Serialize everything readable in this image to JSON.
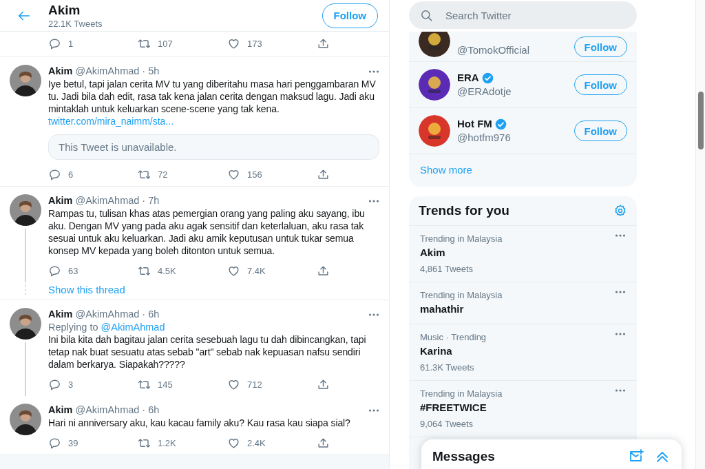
{
  "header": {
    "title": "Akim",
    "subtitle": "22.1K Tweets",
    "follow_button": "Follow"
  },
  "previous_actions": {
    "replies": "1",
    "retweets": "107",
    "likes": "173"
  },
  "timeline": [
    {
      "kind": "tweet",
      "name": "Akim",
      "handle": "@AkimAhmad",
      "time": "· 5h",
      "text": "Iye betul, tapi jalan cerita MV tu yang diberitahu masa hari penggambaran MV tu. Jadi bila dah edit, rasa tak kena jalan cerita dengan maksud lagu. Jadi aku mintaklah untuk keluarkan scene-scene yang tak kena.",
      "link": "twitter.com/mira_naimm/sta...",
      "quote": "This Tweet is unavailable.",
      "connected_below": false,
      "replies": "6",
      "retweets": "72",
      "likes": "156"
    },
    {
      "kind": "tweet",
      "name": "Akim",
      "handle": "@AkimAhmad",
      "time": "· 7h",
      "text": "Rampas tu, tulisan khas atas pemergian orang yang paling aku sayang, ibu aku. Dengan MV yang pada aku agak sensitif dan keterlaluan, aku rasa tak sesuai untuk aku keluarkan. Jadi aku amik keputusan untuk tukar semua konsep MV kepada yang boleh ditonton untuk semua.",
      "connected_below": true,
      "replies": "63",
      "retweets": "4.5K",
      "likes": "7.4K"
    },
    {
      "kind": "show_thread",
      "label": "Show this thread"
    },
    {
      "kind": "tweet",
      "name": "Akim",
      "handle": "@AkimAhmad",
      "time": "· 6h",
      "replying_label": "Replying to",
      "replying_to": "@AkimAhmad",
      "text": "Ini bila kita dah bagitau jalan cerita sesebuah lagu tu dah dibincangkan, tapi tetap nak buat sesuatu atas sebab \"art\" sebab nak kepuasan nafsu sendiri dalam berkarya. Siapakah?????",
      "connected_below": true,
      "replies": "3",
      "retweets": "145",
      "likes": "712"
    },
    {
      "kind": "tweet",
      "name": "Akim",
      "handle": "@AkimAhmad",
      "time": "· 6h",
      "text": "Hari ni anniversary aku, kau kacau family aku? Kau rasa kau siapa sial?",
      "connected_below": false,
      "replies": "39",
      "retweets": "1.2K",
      "likes": "2.4K"
    }
  ],
  "search": {
    "placeholder": "Search Twitter"
  },
  "who_to_follow": {
    "accounts": [
      {
        "handle": "@TomokOfficial",
        "color": "#3a2a22",
        "verified": false,
        "button": "Follow"
      },
      {
        "name": "ERA",
        "handle": "@ERAdotje",
        "color": "#5b2bb5",
        "verified": true,
        "button": "Follow"
      },
      {
        "name": "Hot FM",
        "handle": "@hotfm976",
        "color": "#d9362b",
        "verified": true,
        "button": "Follow"
      }
    ],
    "show_more": "Show more"
  },
  "trends": {
    "title": "Trends for you",
    "items": [
      {
        "context": "Trending in Malaysia",
        "topic": "Akim",
        "count": "4,861 Tweets"
      },
      {
        "context": "Trending in Malaysia",
        "topic": "mahathir"
      },
      {
        "context": "Music · Trending",
        "topic": "Karina",
        "count": "61.3K Tweets"
      },
      {
        "context": "Trending in Malaysia",
        "topic": "#FREETWICE",
        "count": "9,064 Tweets"
      }
    ]
  },
  "messages": {
    "title": "Messages"
  }
}
